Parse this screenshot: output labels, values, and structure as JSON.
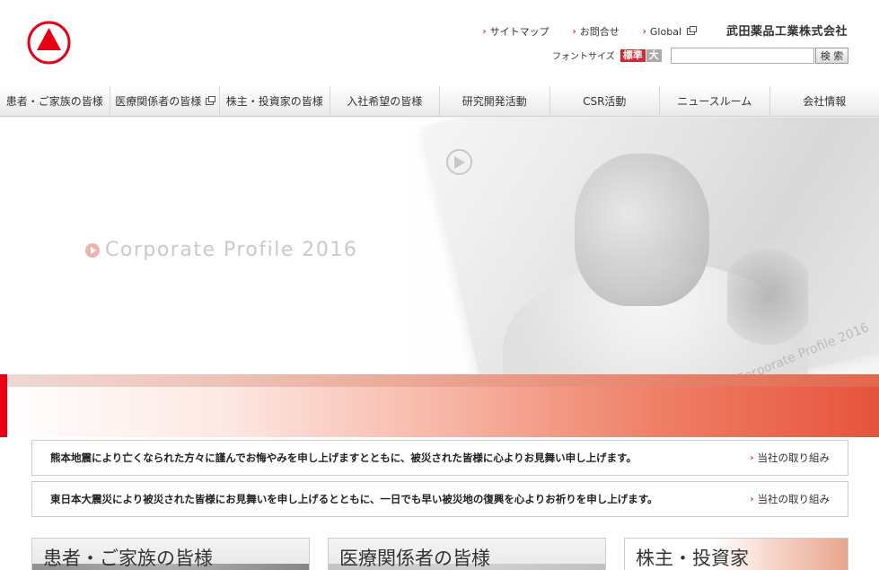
{
  "header": {
    "company_name": "武田薬品工業株式会社",
    "util_links": [
      {
        "label": "サイトマップ"
      },
      {
        "label": "お問合せ"
      },
      {
        "label": "Global"
      }
    ],
    "font_size_label": "フォントサイズ",
    "font_size_normal": "標準",
    "font_size_large": "大",
    "search_value": "",
    "search_button": "検 索"
  },
  "nav": [
    {
      "label": "患者・ご家族の皆様"
    },
    {
      "label": "医療関係者の皆様"
    },
    {
      "label": "株主・投資家の皆様"
    },
    {
      "label": "入社希望の皆様"
    },
    {
      "label": "研究開発活動"
    },
    {
      "label": "CSR活動"
    },
    {
      "label": "ニュースルーム"
    },
    {
      "label": "会社情報"
    }
  ],
  "hero": {
    "title": "Corporate Profile 2016",
    "book_text": "Corporate Profile 2016"
  },
  "notices": [
    {
      "text": "熊本地震により亡くなられた方々に謹んでお悔やみを申し上げますとともに、被災された皆様に心よりお見舞い申し上げます。",
      "link": "当社の取り組み"
    },
    {
      "text": "東日本大震災により被災された皆様にお見舞いを申し上げるとともに、一日でも早い被災地の復興を心よりお祈りを申し上げます。",
      "link": "当社の取り組み"
    }
  ],
  "cards": [
    {
      "title": "患者・ご家族の皆様"
    },
    {
      "title": "医療関係者の皆様"
    },
    {
      "title": "株主・投資家"
    }
  ],
  "colors": {
    "brand_red": "#e60012",
    "accent_red": "#d4272d"
  }
}
